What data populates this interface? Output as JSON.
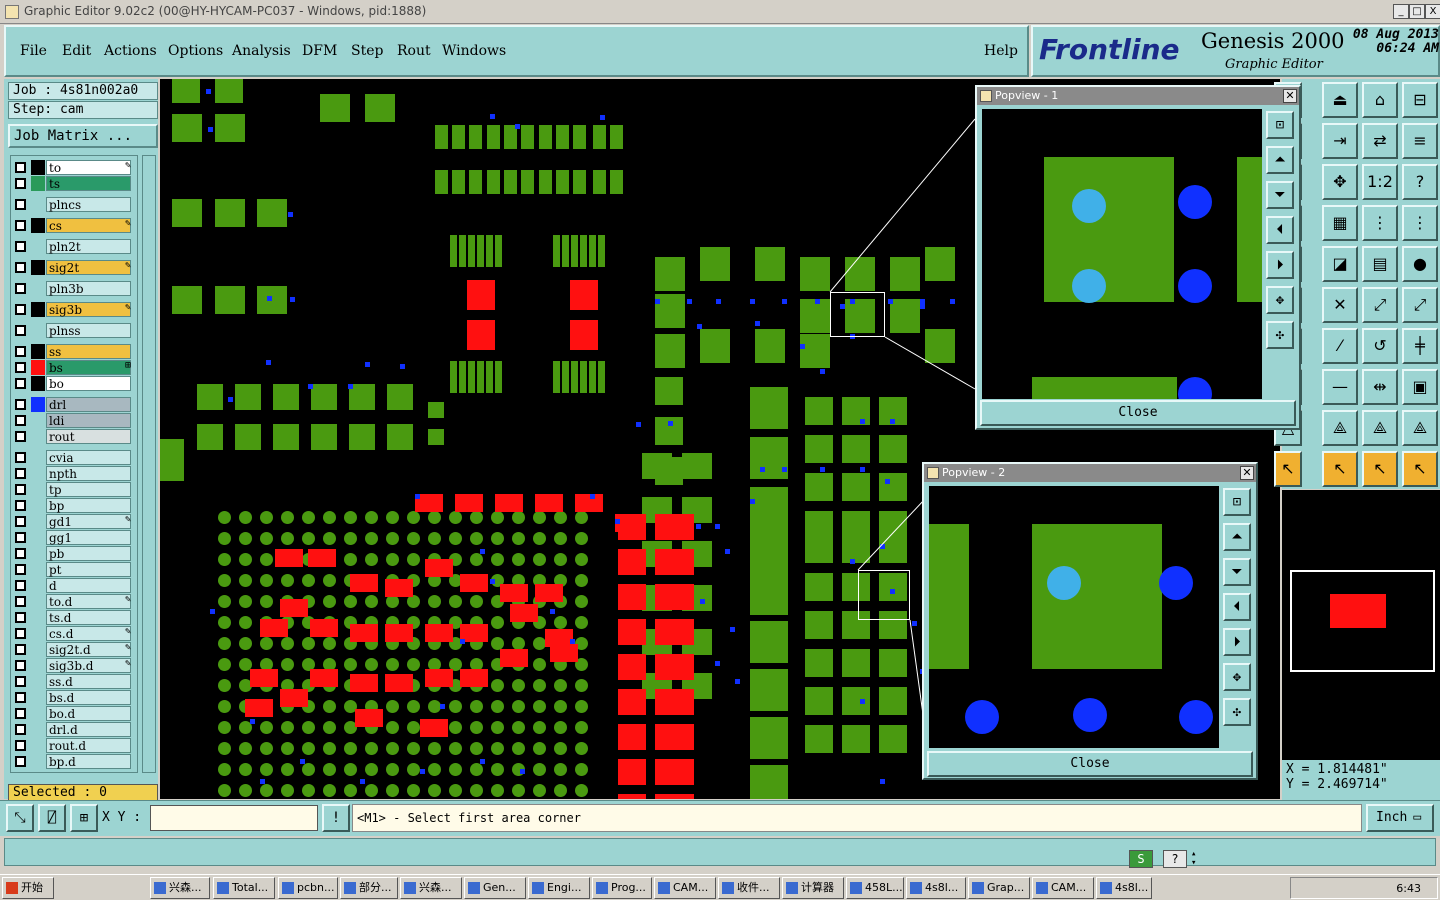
{
  "window": {
    "title": "Graphic Editor 9.02c2 (00@HY-HYCAM-PC037 - Windows, pid:1888)",
    "controls": [
      "_",
      "□",
      "X"
    ]
  },
  "menu": {
    "items": [
      "File",
      "Edit",
      "Actions",
      "Options",
      "Analysis",
      "DFM",
      "Step",
      "Rout",
      "Windows"
    ],
    "help": "Help"
  },
  "brand": {
    "logo_pre": "Frontline",
    "product": "Genesis 2000",
    "subtitle": "Graphic Editor",
    "date": "08 Aug 2013",
    "time": "06:24 AM"
  },
  "job": {
    "job_label": "Job : 4s81n002a0",
    "step_label": "Step: cam",
    "matrix_button": "Job Matrix ..."
  },
  "layers": [
    {
      "name": "to",
      "color": "#000000",
      "bg": "#ffffff",
      "mark": "✎"
    },
    {
      "name": "ts",
      "color": "#2a9a5a",
      "bg": "#2a9a6a",
      "mark": ""
    },
    {
      "name": "plncs",
      "color": "#9cd4d2",
      "bg": "#c8e8e8",
      "mark": ""
    },
    {
      "name": "cs",
      "color": "#000000",
      "bg": "#f0c040",
      "mark": "✎"
    },
    {
      "name": "pln2t",
      "color": "#9cd4d2",
      "bg": "#c8e8e8",
      "mark": ""
    },
    {
      "name": "sig2t",
      "color": "#000000",
      "bg": "#f0c040",
      "mark": "✎"
    },
    {
      "name": "pln3b",
      "color": "#9cd4d2",
      "bg": "#c8e8e8",
      "mark": ""
    },
    {
      "name": "sig3b",
      "color": "#000000",
      "bg": "#f0c040",
      "mark": "✎"
    },
    {
      "name": "plnss",
      "color": "#9cd4d2",
      "bg": "#c8e8e8",
      "mark": ""
    },
    {
      "name": "ss",
      "color": "#000000",
      "bg": "#f0c040",
      "mark": ""
    },
    {
      "name": "bs",
      "color": "#ff1010",
      "bg": "#2a9a6a",
      "mark": "⊞"
    },
    {
      "name": "bo",
      "color": "#000000",
      "bg": "#ffffff",
      "mark": ""
    },
    {
      "name": "drl",
      "color": "#1030ff",
      "bg": "#a8b8c0",
      "mark": ""
    },
    {
      "name": "ldi",
      "color": "#9cd4d2",
      "bg": "#a8b8c0",
      "mark": ""
    },
    {
      "name": "rout",
      "color": "#9cd4d2",
      "bg": "#d8e0e0",
      "mark": ""
    },
    {
      "name": "cvia",
      "color": "#9cd4d2",
      "bg": "#c8e8e8",
      "mark": ""
    },
    {
      "name": "npth",
      "color": "#9cd4d2",
      "bg": "#c8e8e8",
      "mark": ""
    },
    {
      "name": "tp",
      "color": "#9cd4d2",
      "bg": "#c8e8e8",
      "mark": ""
    },
    {
      "name": "bp",
      "color": "#9cd4d2",
      "bg": "#c8e8e8",
      "mark": ""
    },
    {
      "name": "gd1",
      "color": "#9cd4d2",
      "bg": "#c8e8e8",
      "mark": "✎"
    },
    {
      "name": "gg1",
      "color": "#9cd4d2",
      "bg": "#c8e8e8",
      "mark": ""
    },
    {
      "name": "pb",
      "color": "#9cd4d2",
      "bg": "#c8e8e8",
      "mark": ""
    },
    {
      "name": "pt",
      "color": "#9cd4d2",
      "bg": "#c8e8e8",
      "mark": ""
    },
    {
      "name": "d",
      "color": "#9cd4d2",
      "bg": "#c8e8e8",
      "mark": ""
    },
    {
      "name": "to.d",
      "color": "#9cd4d2",
      "bg": "#c8e8e8",
      "mark": "✎"
    },
    {
      "name": "ts.d",
      "color": "#9cd4d2",
      "bg": "#c8e8e8",
      "mark": ""
    },
    {
      "name": "cs.d",
      "color": "#9cd4d2",
      "bg": "#c8e8e8",
      "mark": "✎"
    },
    {
      "name": "sig2t.d",
      "color": "#9cd4d2",
      "bg": "#c8e8e8",
      "mark": "✎"
    },
    {
      "name": "sig3b.d",
      "color": "#9cd4d2",
      "bg": "#c8e8e8",
      "mark": "✎"
    },
    {
      "name": "ss.d",
      "color": "#9cd4d2",
      "bg": "#c8e8e8",
      "mark": ""
    },
    {
      "name": "bs.d",
      "color": "#9cd4d2",
      "bg": "#c8e8e8",
      "mark": ""
    },
    {
      "name": "bo.d",
      "color": "#9cd4d2",
      "bg": "#c8e8e8",
      "mark": ""
    },
    {
      "name": "drl.d",
      "color": "#9cd4d2",
      "bg": "#c8e8e8",
      "mark": ""
    },
    {
      "name": "rout.d",
      "color": "#9cd4d2",
      "bg": "#c8e8e8",
      "mark": ""
    },
    {
      "name": "bp.d",
      "color": "#9cd4d2",
      "bg": "#c8e8e8",
      "mark": ""
    }
  ],
  "selected": "Selected : 0",
  "popview1": {
    "title": "Popview - 1",
    "close": "Close"
  },
  "popview2": {
    "title": "Popview - 2",
    "close": "Close"
  },
  "coords": {
    "x": "X = 1.814481\"",
    "y": "Y = 2.469714\""
  },
  "command": {
    "xy_label": "X Y :",
    "xy_value": "",
    "prompt": "<M1> - Select first area corner",
    "units": "Inch"
  },
  "taskbar": {
    "start": "开始",
    "items": [
      "兴森...",
      "Total...",
      "pcbn...",
      "部分...",
      "兴森...",
      "Gen...",
      "Engi...",
      "Prog...",
      "CAM...",
      "收件...",
      "计算器",
      "458L...",
      "4s8l...",
      "Grap...",
      "CAM...",
      "4s8l..."
    ],
    "clock": "6:43"
  },
  "colors": {
    "panel": "#9cd4d2",
    "pad": "#4a9a10",
    "smd_red": "#ff1010",
    "drill_blue": "#1030ff",
    "canvas": "#000000"
  }
}
